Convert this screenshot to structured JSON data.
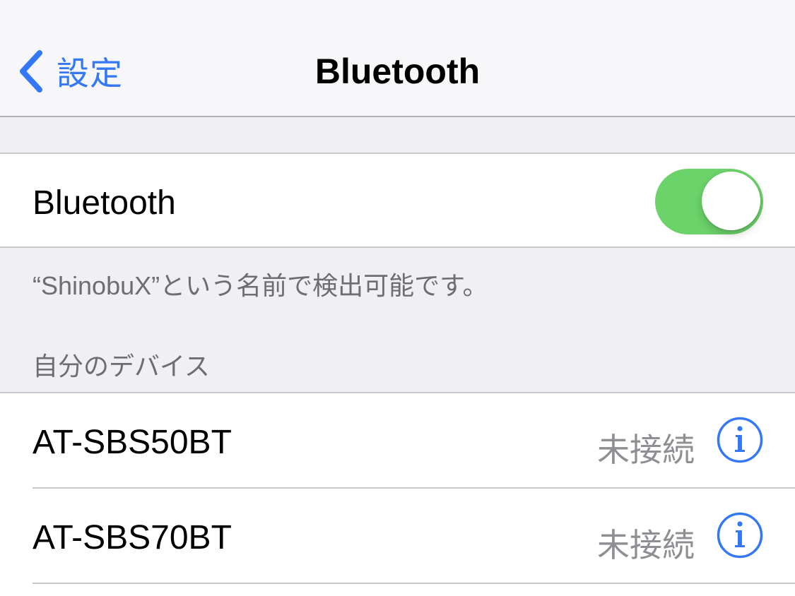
{
  "navbar": {
    "back_label": "設定",
    "title": "Bluetooth"
  },
  "bluetooth_toggle": {
    "label": "Bluetooth",
    "state": "on",
    "on_color": "#6cd26a"
  },
  "discoverable_text": "“ShinobuX”という名前で検出可能です。",
  "my_devices": {
    "header": "自分のデバイス",
    "devices": [
      {
        "name": "AT-SBS50BT",
        "status": "未接続",
        "icon": "info-icon"
      },
      {
        "name": "AT-SBS70BT",
        "status": "未接続",
        "icon": "info-icon"
      }
    ]
  },
  "colors": {
    "accent": "#3478f6",
    "secondary_text": "#6d6d72",
    "status_text": "#8e8e93",
    "background": "#efeff4"
  }
}
